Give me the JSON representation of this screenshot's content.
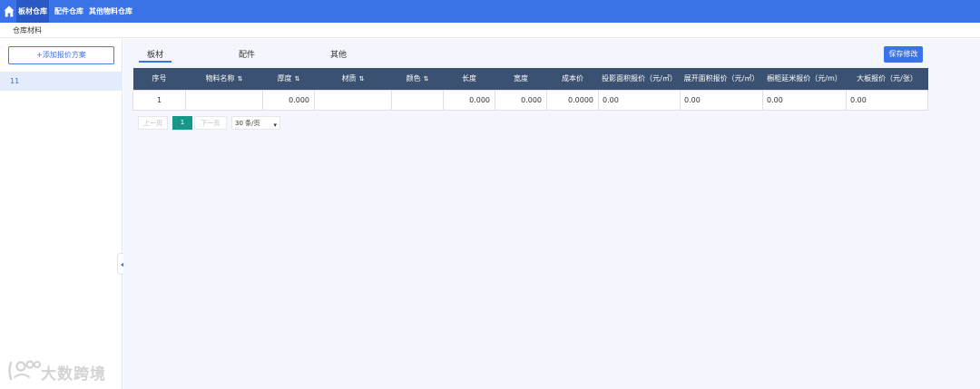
{
  "topnav": {
    "tabs": [
      {
        "label": "板材仓库",
        "active": true
      },
      {
        "label": "配件仓库",
        "active": false
      },
      {
        "label": "其他物料仓库",
        "active": false
      }
    ]
  },
  "subnav": {
    "breadcrumb": "仓库材料"
  },
  "sidebar": {
    "add_button": "+添加报价方案",
    "items": [
      {
        "label": "11",
        "selected": true
      }
    ]
  },
  "main": {
    "tabs": [
      {
        "label": "板材",
        "active": true
      },
      {
        "label": "配件",
        "active": false
      },
      {
        "label": "其他",
        "active": false
      }
    ],
    "save_button": "保存修改"
  },
  "table": {
    "headers": [
      "序号",
      "物料名称",
      "厚度",
      "材质",
      "颜色",
      "长度",
      "宽度",
      "成本价",
      "投影面积报价（元/㎡）",
      "展开面积报价（元/㎡）",
      "橱柜延米报价（元/m）",
      "大板报价（元/张）"
    ],
    "sort_icon": "⇅",
    "rows": [
      [
        "1",
        "",
        "0.000",
        "",
        "",
        "0.000",
        "0.000",
        "0.0000",
        "0.00",
        "0.00",
        "0.00",
        "0.00"
      ]
    ]
  },
  "pagination": {
    "prev": "上一页",
    "current": "1",
    "next": "下一页",
    "page_size": "30 条/页"
  },
  "watermark": {
    "text": "大数跨境"
  },
  "colors": {
    "topbar": "#3a72e8",
    "table_header": "#3b5171",
    "main_background": "#f3f7fd",
    "current_page": "#17968a"
  }
}
